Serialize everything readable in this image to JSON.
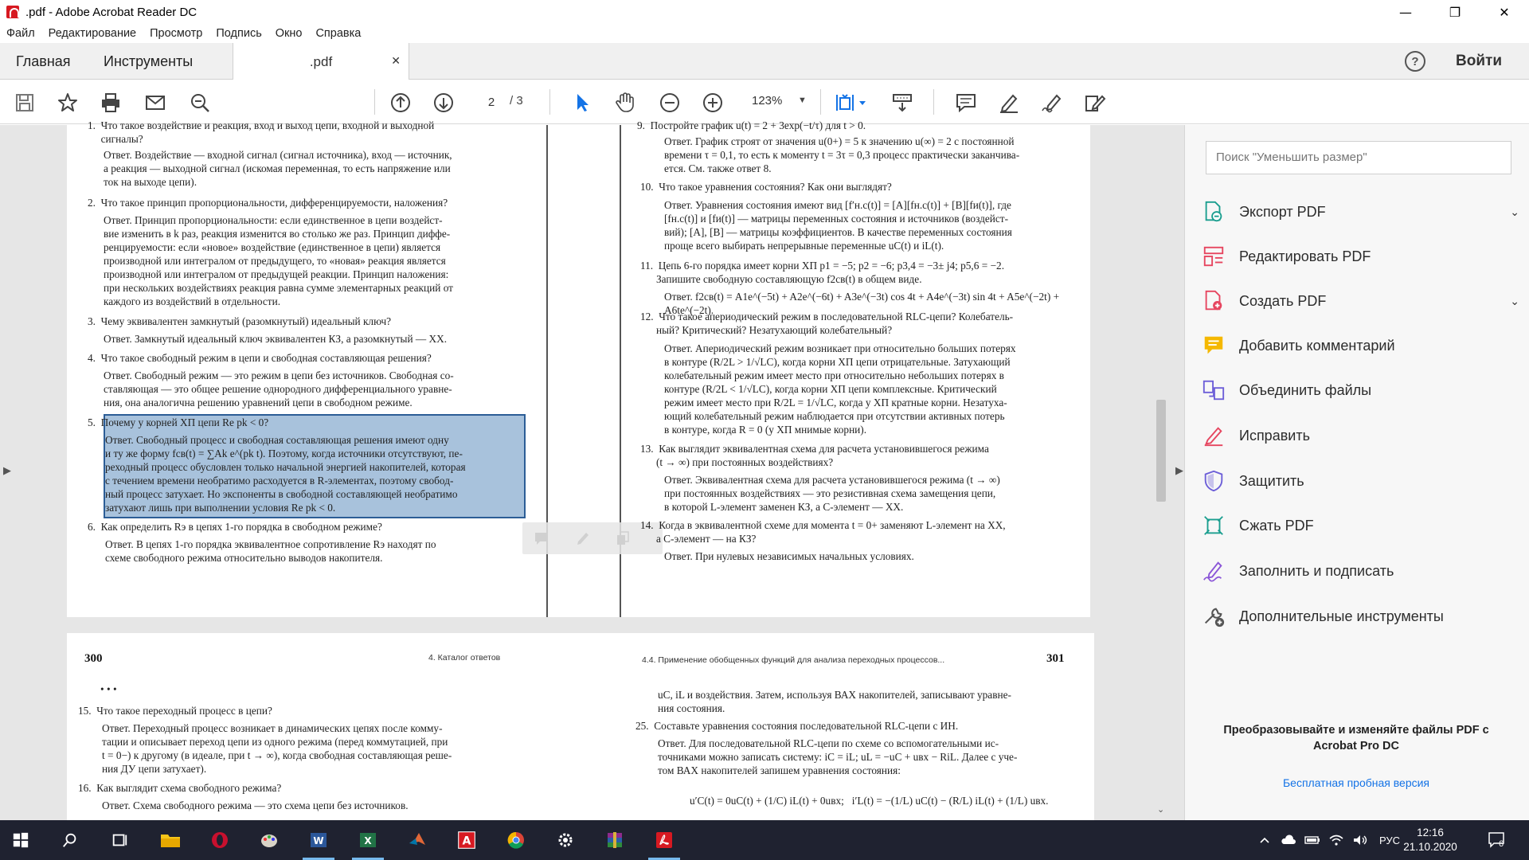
{
  "window": {
    "title": ".pdf - Adobe Acrobat Reader DC",
    "minimize": "—",
    "maximize": "❐",
    "close": "✕"
  },
  "menu": [
    "Файл",
    "Редактирование",
    "Просмотр",
    "Подпись",
    "Окно",
    "Справка"
  ],
  "tabs": {
    "home": "Главная",
    "tools": "Инструменты",
    "doc": ".pdf",
    "doc_close": "✕",
    "help": "?",
    "signin": "Войти"
  },
  "toolbar": {
    "page_current": "2",
    "page_total": "/ 3",
    "zoom": "123%",
    "zoom_caret": "▼"
  },
  "document": {
    "left_page": {
      "item1_cont": "1.  Что такое воздействие и реакция, вход и выход цепи, входной и выходной\n     сигналы?",
      "item1_ans": "Ответ. Воздействие — входной сигнал (сигнал источника), вход — источник,\nа реакция — выходной сигнал (искомая переменная, то есть напряжение или\nток на выходе цепи).",
      "item2_q": "2.  Что такое принцип пропорциональности, дифференцируемости, наложения?",
      "item2_ans": "Ответ. Принцип пропорциональности: если единственное в цепи воздейст-\nвие изменить в k раз, реакция изменится во столько же раз. Принцип диффе-\nренцируемости: если «новое» воздействие (единственное в цепи) является\nпроизводной или интегралом от предыдущего, то «новая» реакция является\nпроизводной или интегралом от предыдущей реакции. Принцип наложения:\nпри нескольких воздействиях реакция равна сумме элементарных реакций от\nкаждого из воздействий в отдельности.",
      "item3_q": "3.  Чему эквивалентен замкнутый (разомкнутый) идеальный ключ?",
      "item3_ans": "Ответ. Замкнутый идеальный ключ эквивалентен КЗ, а разомкнутый — ХХ.",
      "item4_q": "4.  Что такое свободный режим в цепи и свободная составляющая решения?",
      "item4_ans": "Ответ. Свободный режим — это режим в цепи без источников. Свободная со-\nставляющая — это общее решение однородного дифференциального уравне-\nния, она аналогична решению уравнений цепи в свободном режиме.",
      "item5_q": "5.  Почему у корней ХП цепи Re pk < 0?",
      "item5_ans": "Ответ. Свободный процесс и свободная составляющая решения имеют одну\nи ту же форму fсв(t) = ∑Ak e^(pk t). Поэтому, когда источники отсутствуют, пе-\nреходный процесс обусловлен только начальной энергией накопителей, которая\nс течением времени необратимо расходуется в R-элементах, поэтому свобод-\nный процесс затухает. Но экспоненты в свободной составляющей необратимо\nзатухают лишь при выполнении условия Re pk < 0.",
      "item6_q": "6.  Как определить Rэ в цепях 1-го порядка в свободном режиме?",
      "item6_ans": "Ответ. В цепях 1-го порядка эквивалентное сопротивление Rэ находят по\nсхеме свободного режима относительно выводов накопителя."
    },
    "right_page": {
      "item9_cont": "9.  Постройте график u(t) = 2 + 3exp(−t/τ) для t > 0.",
      "item9_ans": "Ответ. График строят от значения u(0+) = 5 к значению u(∞) = 2 с постоянной\nвремени τ = 0,1, то есть к моменту t = 3τ = 0,3 процесс практически заканчива-\nется. См. также ответ 8.",
      "item10_q": "10.  Что такое уравнения состояния? Как они выглядят?",
      "item10_ans": "Ответ. Уравнения состояния имеют вид [f′н.с(t)] = [A][fн.с(t)] + [B][fи(t)], где\n[fн.с(t)] и [fи(t)] — матрицы переменных состояния и источников (воздейст-\nвий); [A], [B] — матрицы коэффициентов. В качестве переменных состояния\nпроще всего выбирать непрерывные переменные uC(t) и iL(t).",
      "item11_q": "11.  Цепь 6-го порядка имеет корни ХП p1 = −5; p2 = −6; p3,4 = −3± j4; p5,6 = −2.\n      Запишите свободную составляющую f2св(t) в общем виде.",
      "item11_ans": "Ответ. f2св(t) = A1e^(−5t) + A2e^(−6t) + A3e^(−3t) cos 4t + A4e^(−3t) sin 4t + A5e^(−2t) + A6te^(−2t).",
      "item12_q": "12.  Что такое апериодический режим в последовательной RLC-цепи? Колебатель-\n      ный? Критический? Незатухающий колебательный?",
      "item12_ans": "Ответ. Апериодический режим возникает при относительно больших потерях\nв контуре (R/2L > 1/√LC), когда корни ХП цепи отрицательные. Затухающий\nколебательный режим имеет место при относительно небольших потерях в\nконтуре (R/2L < 1/√LC), когда корни ХП цепи комплексные. Критический\nрежим имеет место при R/2L = 1/√LC, когда у ХП кратные корни. Незатуха-\nющий колебательный режим наблюдается при отсутствии активных потерь\nв контуре, когда R = 0 (у ХП мнимые корни).",
      "item13_q": "13.  Как выглядит эквивалентная схема для расчета установившегося режима\n      (t → ∞) при постоянных воздействиях?",
      "item13_ans": "Ответ. Эквивалентная схема для расчета установившегося режима (t → ∞)\nпри постоянных воздействиях — это резистивная схема замещения цепи,\nв которой L-элемент заменен КЗ, а C-элемент — ХХ.",
      "item14_q": "14.  Когда в эквивалентной схеме для момента t = 0+ заменяют L-элемент на ХХ,\n      а C-элемент — на КЗ?",
      "item14_ans": "Ответ. При нулевых независимых начальных условиях."
    },
    "bottom": {
      "page_left_num": "300",
      "head_left": "4. Каталог ответов",
      "head_right": "4.4. Применение обобщенных функций для анализа переходных процессов...",
      "page_right_num": "301",
      "dots": "• • •",
      "item15_q": "15.  Что такое переходный процесс в цепи?",
      "item15_ans": "Ответ. Переходный процесс возникает в динамических цепях после комму-\nтации и описывает переход цепи из одного режима (перед коммутацией, при\nt = 0−) к другому (в идеале, при t → ∞), когда свободная составляющая реше-\nния ДУ цепи затухает).",
      "item16_q": "16.  Как выглядит схема свободного режима?",
      "item16_ans": "Ответ. Схема свободного режима — это схема цепи без источников.",
      "right_cont": "uC, iL и воздействия. Затем, используя ВАХ накопителей, записывают уравне-\nния состояния.",
      "item25_q": "25.  Составьте уравнения состояния последовательной RLC-цепи с ИН.",
      "item25_ans": "Ответ. Для последовательной RLC-цепи по схеме со вспомогательными ис-\nточниками можно записать систему: iC = iL; uL = −uC + uвх − RiL. Далее с уче-\nтом ВАХ накопителей запишем уравнения состояния:",
      "item25_eq": "u′C(t) = 0uC(t) + (1/C) iL(t) + 0uвх;   i′L(t) = −(1/L) uC(t) − (R/L) iL(t) + (1/L) uвх."
    }
  },
  "right_panel": {
    "search_placeholder": "Поиск \"Уменьшить размер\"",
    "tools": [
      {
        "label": "Экспорт PDF",
        "icon": "export-pdf-icon",
        "caret": true
      },
      {
        "label": "Редактировать PDF",
        "icon": "edit-pdf-icon",
        "caret": false
      },
      {
        "label": "Создать PDF",
        "icon": "create-pdf-icon",
        "caret": true
      },
      {
        "label": "Добавить комментарий",
        "icon": "comment-icon",
        "caret": false
      },
      {
        "label": "Объединить файлы",
        "icon": "combine-files-icon",
        "caret": false
      },
      {
        "label": "Исправить",
        "icon": "fix-icon",
        "caret": false
      },
      {
        "label": "Защитить",
        "icon": "protect-icon",
        "caret": false
      },
      {
        "label": "Сжать PDF",
        "icon": "compress-pdf-icon",
        "caret": false
      },
      {
        "label": "Заполнить и подписать",
        "icon": "fill-sign-icon",
        "caret": false
      },
      {
        "label": "Дополнительные инструменты",
        "icon": "more-tools-icon",
        "caret": false
      }
    ],
    "promo": "Преобразовывайте и изменяйте файлы PDF с Acrobat Pro DC",
    "trial": "Бесплатная пробная версия",
    "caret": "⌄"
  },
  "taskbar": {
    "lang": "РУС",
    "time": "12:16",
    "date": "21.10.2020",
    "notif_count": "6"
  },
  "colors": {
    "accent": "#1473e6",
    "highlight": "#6090c0",
    "taskbar": "#1f2230",
    "adobe_red": "#d71921"
  }
}
